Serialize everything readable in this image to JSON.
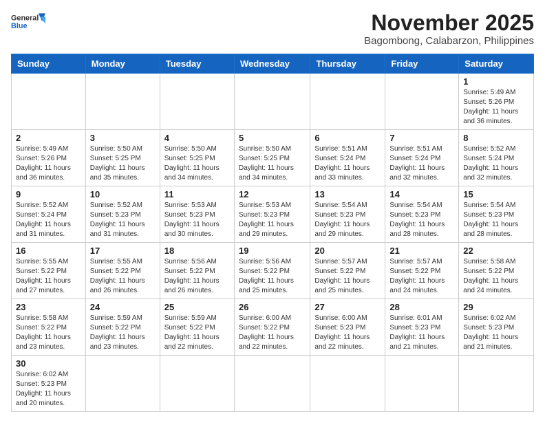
{
  "header": {
    "logo_general": "General",
    "logo_blue": "Blue",
    "month": "November 2025",
    "location": "Bagombong, Calabarzon, Philippines"
  },
  "days_of_week": [
    "Sunday",
    "Monday",
    "Tuesday",
    "Wednesday",
    "Thursday",
    "Friday",
    "Saturday"
  ],
  "weeks": [
    [
      {
        "day": "",
        "info": ""
      },
      {
        "day": "",
        "info": ""
      },
      {
        "day": "",
        "info": ""
      },
      {
        "day": "",
        "info": ""
      },
      {
        "day": "",
        "info": ""
      },
      {
        "day": "",
        "info": ""
      },
      {
        "day": "1",
        "info": "Sunrise: 5:49 AM\nSunset: 5:26 PM\nDaylight: 11 hours\nand 36 minutes."
      }
    ],
    [
      {
        "day": "2",
        "info": "Sunrise: 5:49 AM\nSunset: 5:26 PM\nDaylight: 11 hours\nand 36 minutes."
      },
      {
        "day": "3",
        "info": "Sunrise: 5:50 AM\nSunset: 5:25 PM\nDaylight: 11 hours\nand 35 minutes."
      },
      {
        "day": "4",
        "info": "Sunrise: 5:50 AM\nSunset: 5:25 PM\nDaylight: 11 hours\nand 34 minutes."
      },
      {
        "day": "5",
        "info": "Sunrise: 5:50 AM\nSunset: 5:25 PM\nDaylight: 11 hours\nand 34 minutes."
      },
      {
        "day": "6",
        "info": "Sunrise: 5:51 AM\nSunset: 5:24 PM\nDaylight: 11 hours\nand 33 minutes."
      },
      {
        "day": "7",
        "info": "Sunrise: 5:51 AM\nSunset: 5:24 PM\nDaylight: 11 hours\nand 32 minutes."
      },
      {
        "day": "8",
        "info": "Sunrise: 5:52 AM\nSunset: 5:24 PM\nDaylight: 11 hours\nand 32 minutes."
      }
    ],
    [
      {
        "day": "9",
        "info": "Sunrise: 5:52 AM\nSunset: 5:24 PM\nDaylight: 11 hours\nand 31 minutes."
      },
      {
        "day": "10",
        "info": "Sunrise: 5:52 AM\nSunset: 5:23 PM\nDaylight: 11 hours\nand 31 minutes."
      },
      {
        "day": "11",
        "info": "Sunrise: 5:53 AM\nSunset: 5:23 PM\nDaylight: 11 hours\nand 30 minutes."
      },
      {
        "day": "12",
        "info": "Sunrise: 5:53 AM\nSunset: 5:23 PM\nDaylight: 11 hours\nand 29 minutes."
      },
      {
        "day": "13",
        "info": "Sunrise: 5:54 AM\nSunset: 5:23 PM\nDaylight: 11 hours\nand 29 minutes."
      },
      {
        "day": "14",
        "info": "Sunrise: 5:54 AM\nSunset: 5:23 PM\nDaylight: 11 hours\nand 28 minutes."
      },
      {
        "day": "15",
        "info": "Sunrise: 5:54 AM\nSunset: 5:23 PM\nDaylight: 11 hours\nand 28 minutes."
      }
    ],
    [
      {
        "day": "16",
        "info": "Sunrise: 5:55 AM\nSunset: 5:22 PM\nDaylight: 11 hours\nand 27 minutes."
      },
      {
        "day": "17",
        "info": "Sunrise: 5:55 AM\nSunset: 5:22 PM\nDaylight: 11 hours\nand 26 minutes."
      },
      {
        "day": "18",
        "info": "Sunrise: 5:56 AM\nSunset: 5:22 PM\nDaylight: 11 hours\nand 26 minutes."
      },
      {
        "day": "19",
        "info": "Sunrise: 5:56 AM\nSunset: 5:22 PM\nDaylight: 11 hours\nand 25 minutes."
      },
      {
        "day": "20",
        "info": "Sunrise: 5:57 AM\nSunset: 5:22 PM\nDaylight: 11 hours\nand 25 minutes."
      },
      {
        "day": "21",
        "info": "Sunrise: 5:57 AM\nSunset: 5:22 PM\nDaylight: 11 hours\nand 24 minutes."
      },
      {
        "day": "22",
        "info": "Sunrise: 5:58 AM\nSunset: 5:22 PM\nDaylight: 11 hours\nand 24 minutes."
      }
    ],
    [
      {
        "day": "23",
        "info": "Sunrise: 5:58 AM\nSunset: 5:22 PM\nDaylight: 11 hours\nand 23 minutes."
      },
      {
        "day": "24",
        "info": "Sunrise: 5:59 AM\nSunset: 5:22 PM\nDaylight: 11 hours\nand 23 minutes."
      },
      {
        "day": "25",
        "info": "Sunrise: 5:59 AM\nSunset: 5:22 PM\nDaylight: 11 hours\nand 22 minutes."
      },
      {
        "day": "26",
        "info": "Sunrise: 6:00 AM\nSunset: 5:22 PM\nDaylight: 11 hours\nand 22 minutes."
      },
      {
        "day": "27",
        "info": "Sunrise: 6:00 AM\nSunset: 5:23 PM\nDaylight: 11 hours\nand 22 minutes."
      },
      {
        "day": "28",
        "info": "Sunrise: 6:01 AM\nSunset: 5:23 PM\nDaylight: 11 hours\nand 21 minutes."
      },
      {
        "day": "29",
        "info": "Sunrise: 6:02 AM\nSunset: 5:23 PM\nDaylight: 11 hours\nand 21 minutes."
      }
    ],
    [
      {
        "day": "30",
        "info": "Sunrise: 6:02 AM\nSunset: 5:23 PM\nDaylight: 11 hours\nand 20 minutes."
      },
      {
        "day": "",
        "info": ""
      },
      {
        "day": "",
        "info": ""
      },
      {
        "day": "",
        "info": ""
      },
      {
        "day": "",
        "info": ""
      },
      {
        "day": "",
        "info": ""
      },
      {
        "day": "",
        "info": ""
      }
    ]
  ]
}
